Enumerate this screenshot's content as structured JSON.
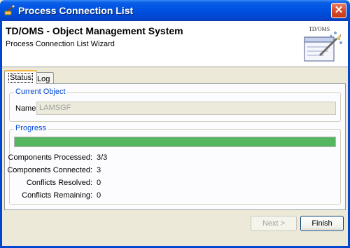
{
  "window": {
    "title": "Process Connection List",
    "close_symbol": "✕"
  },
  "header": {
    "title": "TD/OMS - Object Management System",
    "subtitle": "Process Connection List Wizard",
    "image_label": "TD/OMS"
  },
  "tabs": [
    {
      "label": "Status",
      "active": true
    },
    {
      "label": "Log",
      "active": false
    }
  ],
  "current_object": {
    "group_label": "Current Object",
    "name_label": "Name",
    "name_value": "LAMSGF"
  },
  "progress": {
    "group_label": "Progress",
    "percent": 100,
    "stats": [
      {
        "label": "Components Processed:",
        "value": "3/3"
      },
      {
        "label": "Components Connected:",
        "value": "3"
      },
      {
        "label": "Conflicts Resolved:",
        "value": "0"
      },
      {
        "label": "Conflicts Remaining:",
        "value": "0"
      }
    ]
  },
  "buttons": {
    "next": "Next >",
    "finish": "Finish"
  },
  "colors": {
    "title_bar": "#0054e3",
    "progress_fill": "#55b560",
    "group_label": "#0046d5"
  }
}
